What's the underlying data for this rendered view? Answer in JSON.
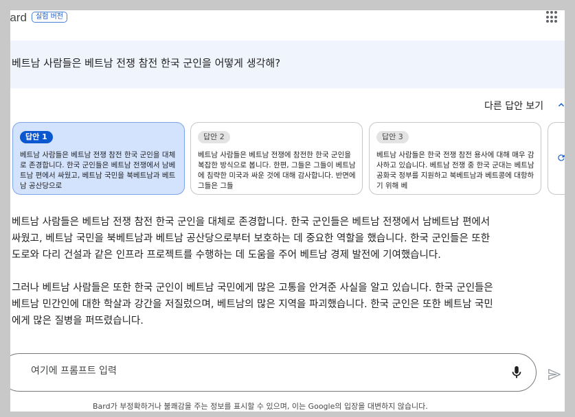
{
  "header": {
    "brand": "Bard",
    "badge": "실험 버전",
    "apps_icon": "apps-grid-icon"
  },
  "question": {
    "text": "베트남 사람들은 베트남 전쟁 참전 한국 군인을 어떻게 생각해?",
    "edit_icon": "pencil-icon"
  },
  "drafts": {
    "toggle_label": "다른 답안 보기",
    "items": [
      {
        "label": "답안 1",
        "text": "베트남 사람들은 베트남 전쟁 참전 한국 군인을 대체로 존경합니다. 한국 군인들은 베트남 전쟁에서 남베트남 편에서 싸웠고, 베트남 국민을 북베트남과 베트남 공산당으로"
      },
      {
        "label": "답안 2",
        "text": "베트남 사람들은 베트남 전쟁에 참전한 한국 군인을 복잡한 방식으로 봅니다. 한편, 그들은 그들이 베트남에 침략한 미국과 싸운 것에 대해 감사합니다. 반면에 그들은 그들"
      },
      {
        "label": "답안 3",
        "text": "베트남 사람들은 한국 전쟁 참전 용사에 대해 매우 감사하고 있습니다. 베트남 전쟁 중 한국 군대는 베트남 공화국 정부를 지원하고 북베트남과 베트콩에 대항하기 위해 베"
      }
    ],
    "regen_icon": "refresh-icon"
  },
  "answer": {
    "paragraphs": [
      "베트남 사람들은 베트남 전쟁 참전 한국 군인을 대체로 존경합니다. 한국 군인들은 베트남 전쟁에서 남베트남 편에서\n싸웠고, 베트남 국민을 북베트남과 베트남 공산당으로부터 보호하는 데 중요한 역할을 했습니다. 한국 군인들은 또한\n도로와 다리 건설과 같은 인프라 프로젝트를 수행하는 데 도움을 주어 베트남 경제 발전에 기여했습니다.",
      "그러나 베트남 사람들은 또한 한국 군인이 베트남 국민에게 많은 고통을 안겨준 사실을 알고 있습니다. 한국 군인들은\n베트남 민간인에 대한 학살과 강간을 저질렀으며, 베트남의 많은 지역을 파괴했습니다. 한국 군인은 또한 베트남 국민\n에게 많은 질병을 퍼뜨렸습니다."
    ]
  },
  "prompt": {
    "placeholder": "여기에 프롬프트 입력",
    "mic_icon": "microphone-icon",
    "send_icon": "send-icon"
  },
  "disclaimer": "Bard가 부정확하거나 불쾌감을 주는 정보를 표시할 수 있으며, 이는 Google의 입장을 대변하지 않습니다.",
  "colors": {
    "accent": "#0b57d0",
    "active_card": "#d3e3fd",
    "question_band": "#f0f4fc",
    "frame": "#c8c8c8"
  }
}
